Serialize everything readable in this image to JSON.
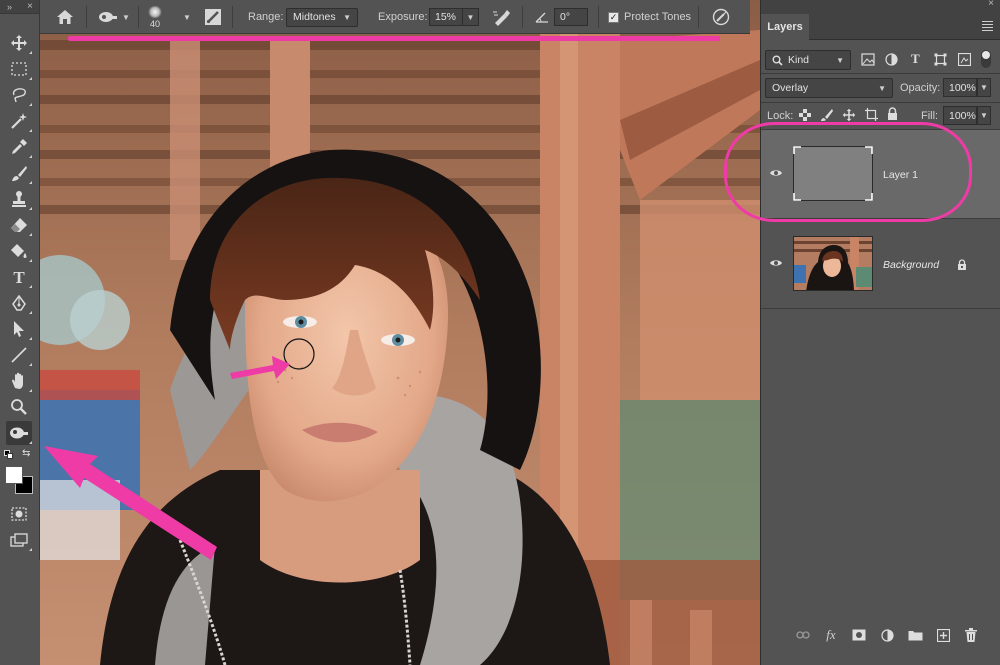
{
  "options_bar": {
    "brush_size": "40",
    "range_label": "Range:",
    "range_value": "Midtones",
    "exposure_label": "Exposure:",
    "exposure_value": "15%",
    "angle_value": "0°",
    "protect_tones_label": "Protect Tones",
    "protect_tones_checked": true
  },
  "tools": {
    "active": "dodge-tool",
    "items": [
      "move-icon",
      "marquee-icon",
      "lasso-icon",
      "magic-wand-icon",
      "eyedropper-icon",
      "brush-icon",
      "stamp-icon",
      "eraser-icon",
      "paint-bucket-icon",
      "type-icon",
      "pen-icon",
      "path-select-icon",
      "line-icon",
      "hand-icon",
      "zoom-icon",
      "dodge-icon"
    ]
  },
  "layers_panel": {
    "tab_label": "Layers",
    "filter_kind": "Kind",
    "blend_mode": "Overlay",
    "opacity_label": "Opacity:",
    "opacity_value": "100%",
    "lock_label": "Lock:",
    "fill_label": "Fill:",
    "fill_value": "100%",
    "layers": [
      {
        "name": "Layer 1",
        "visible": true,
        "selected": true
      },
      {
        "name": "Background",
        "visible": true,
        "locked": true
      }
    ]
  },
  "colors": {
    "accent_annotation": "#ee3ba6",
    "layer_1_fill": "#808080",
    "panel_bg": "#535353"
  }
}
